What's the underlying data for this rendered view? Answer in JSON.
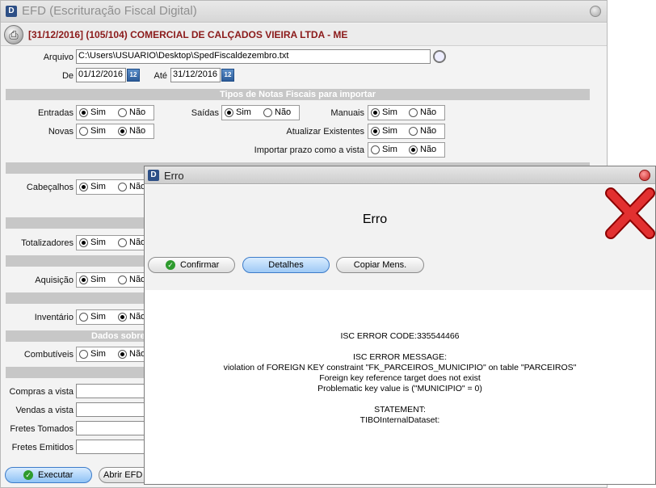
{
  "main": {
    "title": "EFD (Escrituração Fiscal Digital)",
    "company": "[31/12/2016] (105/104) COMERCIAL DE CALÇADOS VIEIRA LTDA - ME",
    "arquivo_label": "Arquivo",
    "arquivo_value": "C:\\Users\\USUARIO\\Desktop\\SpedFiscaldezembro.txt",
    "de_label": "De",
    "de_value": "01/12/2016",
    "ate_label": "Até",
    "ate_value": "31/12/2016",
    "section_tipos": "Tipos de Notas Fiscais para importar",
    "section_dados": "Dados sobre",
    "sim": "Sim",
    "nao": "Não",
    "labels": {
      "entradas": "Entradas",
      "saidas": "Saídas",
      "manuais": "Manuais",
      "novas": "Novas",
      "atualizar": "Atualizar Existentes",
      "prazo": "Importar prazo como a vista",
      "cabecalhos": "Cabeçalhos",
      "totalizadores": "Totalizadores",
      "aquisicao": "Aquisição",
      "inventario": "Inventário",
      "combustiveis": "Combutíveis",
      "compras": "Compras a vista",
      "vendas": "Vendas a vista",
      "fretes_tomados": "Fretes Tomados",
      "fretes_emitidos": "Fretes Emitidos"
    },
    "executar": "Executar",
    "abrir_efd": "Abrir EFD -"
  },
  "dialog": {
    "title": "Erro",
    "heading": "Erro",
    "confirmar": "Confirmar",
    "detalhes": "Detalhes",
    "copiar": "Copiar Mens.",
    "code_line": "ISC ERROR CODE:335544466",
    "msg_title": "ISC ERROR MESSAGE:",
    "msg_line1": "violation of FOREIGN KEY constraint \"FK_PARCEIROS_MUNICIPIO\" on table \"PARCEIROS\"",
    "msg_line2": "Foreign key reference target does not exist",
    "msg_line3": "Problematic key value is (\"MUNICIPIO\" = 0)",
    "statement_title": "STATEMENT:",
    "statement_value": "TIBOInternalDataset:"
  }
}
